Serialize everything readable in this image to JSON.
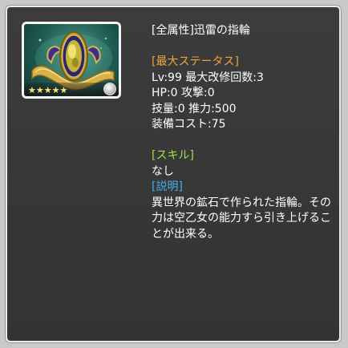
{
  "item": {
    "name": "[全属性]迅雷の指輪",
    "rarity_stars": "★★★★★",
    "icon": "ring-icon"
  },
  "status": {
    "header": "[最大ステータス]",
    "lines": [
      "Lv:99 最大改修回数:3",
      "HP:0 攻撃:0",
      "技量:0 推力:500",
      "装備コスト:75"
    ]
  },
  "skill": {
    "header": "[スキル]",
    "value": "なし"
  },
  "description": {
    "header": "[説明]",
    "text": "異世界の鉱石で作られた指輪。その力は空乙女の能力すら引き上げることが出来る。"
  },
  "colors": {
    "panel_bg": "#363636",
    "status_header": "#f0a23a",
    "skill_header": "#9fe04a",
    "description_header": "#3fb0f0"
  }
}
